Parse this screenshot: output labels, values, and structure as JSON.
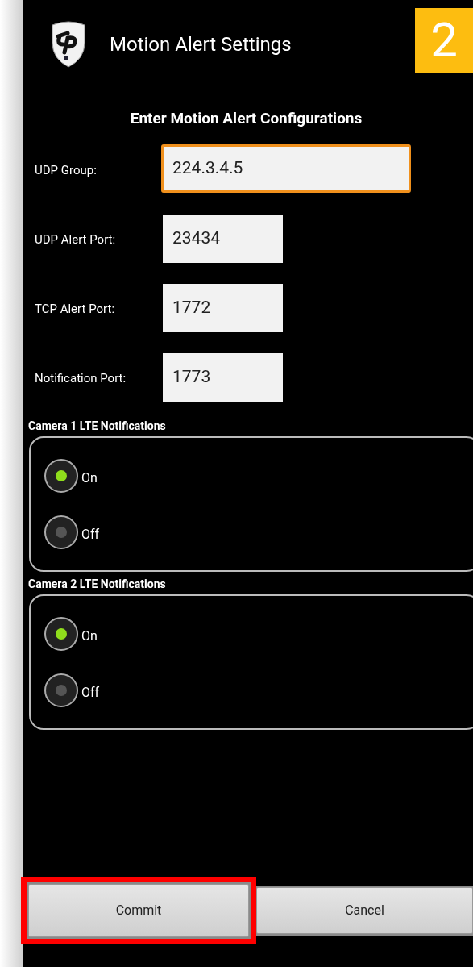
{
  "dialog": {
    "title": "Motion Alert Settings",
    "heading": "Enter Motion Alert Configurations"
  },
  "step_badge": "2",
  "fields": [
    {
      "label": "UDP Group:",
      "value": "224.3.4.5",
      "focused": true
    },
    {
      "label": "UDP Alert Port:",
      "value": "23434",
      "focused": false
    },
    {
      "label": "TCP Alert Port:",
      "value": "1772",
      "focused": false
    },
    {
      "label": "Notification Port:",
      "value": "1773",
      "focused": false
    }
  ],
  "groups": [
    {
      "label": "Camera 1 LTE Notifications",
      "options": [
        {
          "label": "On",
          "selected": true
        },
        {
          "label": "Off",
          "selected": false
        }
      ]
    },
    {
      "label": "Camera 2 LTE Notifications",
      "options": [
        {
          "label": "On",
          "selected": true
        },
        {
          "label": "Off",
          "selected": false
        }
      ]
    }
  ],
  "buttons": [
    {
      "label": "Commit",
      "highlighted": true
    },
    {
      "label": "Cancel",
      "highlighted": false
    }
  ]
}
